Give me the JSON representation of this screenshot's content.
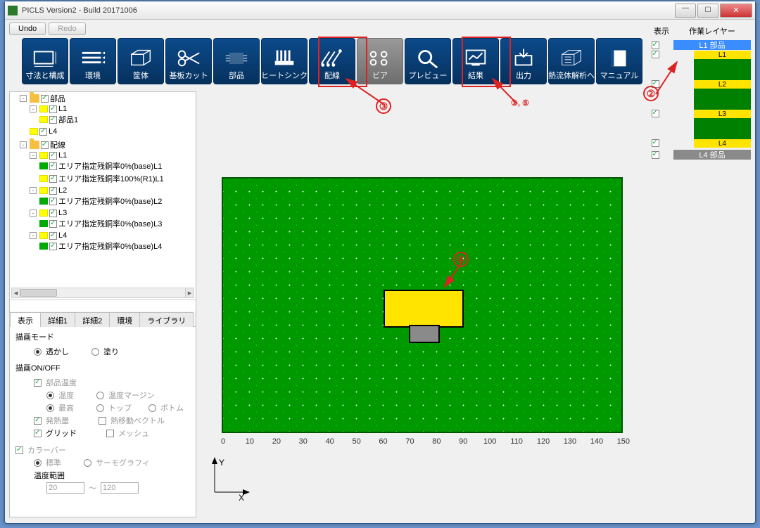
{
  "window": {
    "title": "PICLS Version2 - Build 20171006"
  },
  "undo": {
    "undo": "Undo",
    "redo": "Redo"
  },
  "toolbar": [
    {
      "label": "寸法と構成",
      "icon": "dims"
    },
    {
      "label": "環境",
      "icon": "env"
    },
    {
      "label": "筐体",
      "icon": "encl"
    },
    {
      "label": "基板カット",
      "icon": "cut"
    },
    {
      "label": "部品",
      "icon": "chip"
    },
    {
      "label": "ヒートシンク",
      "icon": "heatsink"
    },
    {
      "label": "配線",
      "icon": "trace",
      "highlighted": true
    },
    {
      "label": "ビア",
      "icon": "via",
      "grey": true
    },
    {
      "label": "プレビュー",
      "icon": "preview"
    },
    {
      "label": "結果",
      "icon": "result",
      "highlighted": true
    },
    {
      "label": "出力",
      "icon": "export"
    },
    {
      "label": "熱流体解析へ",
      "icon": "cfd"
    },
    {
      "label": "マニュアル",
      "icon": "manual"
    }
  ],
  "tree": {
    "root_parts": "部品",
    "l1": "L1",
    "part1": "部品1",
    "l4": "L4",
    "root_wires": "配線",
    "w_l1": "L1",
    "w_l1_a": "エリア指定残銅率0%(base)L1",
    "w_l1_b": "エリア指定残銅率100%(R1)L1",
    "w_l2": "L2",
    "w_l2_a": "エリア指定残銅率0%(base)L2",
    "w_l3": "L3",
    "w_l3_a": "エリア指定残銅率0%(base)L3",
    "w_l4": "L4",
    "w_l4_a": "エリア指定残銅率0%(base)L4"
  },
  "tabs": {
    "t1": "表示",
    "t2": "詳細1",
    "t3": "詳細2",
    "t4": "環境",
    "t5": "ライブラリ"
  },
  "panel": {
    "draw_mode": "描画モード",
    "transparent": "透かし",
    "fill": "塗り",
    "draw_onoff": "描画ON/OFF",
    "part_temp": "部品温度",
    "temp": "温度",
    "temp_margin": "温度マージン",
    "max": "最高",
    "top": "トップ",
    "bottom": "ボトム",
    "heat": "発熱量",
    "heat_vec": "熱移動ベクトル",
    "grid": "グリッド",
    "mesh": "メッシュ",
    "colorbar": "カラーバー",
    "standard": "標準",
    "thermo": "サーモグラフィ",
    "temp_range": "温度範囲",
    "range_lo": "20",
    "range_hi": "120",
    "tilde": "～"
  },
  "axis": {
    "ticks": [
      "0",
      "10",
      "20",
      "30",
      "40",
      "50",
      "60",
      "70",
      "80",
      "90",
      "100",
      "110",
      "120",
      "130",
      "140",
      "150"
    ],
    "y": "Y",
    "x": "X"
  },
  "right": {
    "hdr_show": "表示",
    "hdr_work": "作業レイヤー",
    "layers": [
      {
        "name": "L1 部品",
        "style": "sel"
      },
      {
        "name": "L1",
        "style": "y"
      },
      {
        "name": "",
        "style": "g"
      },
      {
        "name": "L2",
        "style": "y"
      },
      {
        "name": "",
        "style": "g"
      },
      {
        "name": "L3",
        "style": "y"
      },
      {
        "name": "",
        "style": "g"
      },
      {
        "name": "L4",
        "style": "y"
      },
      {
        "name": "L4 部品",
        "style": "grey"
      }
    ]
  },
  "annot": {
    "a1": "①, ⑤",
    "a2": "②",
    "a3": "③",
    "a4": "④"
  }
}
